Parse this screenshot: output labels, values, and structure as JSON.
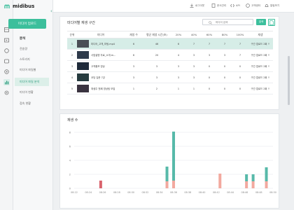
{
  "colors": {
    "accent": "#3cbf9c",
    "views": "#57b9a9",
    "secondary": "#f2a99f",
    "highlight": "#d9636d"
  },
  "brand": {
    "name": "midibus"
  },
  "sidebar": {
    "upload_label": "미디어 업로드",
    "section_label": "분석",
    "items": [
      {
        "label": "전송량"
      },
      {
        "label": "스토리지"
      },
      {
        "label": "미디어 파일별"
      },
      {
        "label": "미디어 파일 분석"
      },
      {
        "label": "미디어 현황"
      },
      {
        "label": "접속 현황"
      }
    ]
  },
  "topbar": {
    "items": [
      {
        "label": "로그아웃",
        "icon": "logout-icon"
      },
      {
        "label": "문서관리",
        "icon": "document-icon"
      },
      {
        "label": "API",
        "icon": "api-icon"
      },
      {
        "label": "고객센터",
        "icon": "support-icon"
      },
      {
        "label": "알림보기",
        "icon": "bell-icon"
      }
    ]
  },
  "table_card": {
    "title": "미디어별 재생 구간",
    "search_placeholder": "미디어 검색",
    "search_label": "검색",
    "columns": [
      "순위",
      "미디어",
      "재생 수",
      "평균 재생 시간(초)",
      "20%",
      "40%",
      "60%",
      "80%",
      "100%",
      "재생"
    ],
    "rows": [
      {
        "rank": "1",
        "title": "미디어_고객_미팅.mp4",
        "plays": "6",
        "avg": "46",
        "p20": "6",
        "p40": "7",
        "p60": "7",
        "p80": "7",
        "p100": "7",
        "action": "구간 업로드 2회 ↑"
      },
      {
        "rank": "2",
        "title": "사업설명 자료_소개.m...",
        "plays": "6",
        "avg": "20",
        "p20": "4",
        "p40": "3",
        "p60": "3",
        "p80": "3",
        "p100": "7",
        "action": "구간 업로드 2회 ↑"
      },
      {
        "rank": "3",
        "title": "고객홍보 영상",
        "plays": "3",
        "avg": "3",
        "p20": "3",
        "p40": "3",
        "p60": "0",
        "p80": "0",
        "p100": "0",
        "action": "구간 업로드 2회 ↑"
      },
      {
        "rank": "4",
        "title": "코딩 입문 7강",
        "plays": "3",
        "avg": "3",
        "p20": "3",
        "p40": "3",
        "p60": "0",
        "p80": "0",
        "p100": "0",
        "action": "구간 업로드 2회 ↑"
      },
      {
        "rank": "5",
        "title": "재생주 첫째 영상팀 모집",
        "plays": "1",
        "avg": "2",
        "p20": "1",
        "p40": "1",
        "p60": "0",
        "p80": "0",
        "p100": "0",
        "action": "구간 업로드 2회 ↑"
      }
    ]
  },
  "chart_card": {
    "title": "재생 수"
  },
  "chart_data": {
    "type": "bar",
    "categories": [
      "08:22",
      "08:24",
      "08:26",
      "08:28",
      "08:30",
      "08:32",
      "08:34",
      "08:36",
      "08:38",
      "08:40",
      "08:42",
      "08:44",
      "08:46",
      "08:48",
      "08:50",
      "08:52",
      "08:54",
      "08:56",
      "08:58",
      "09:00",
      "09:02",
      "09:04",
      "09:06",
      "09:08",
      "09:10",
      "09:12",
      "09:14",
      "09:16",
      "09:18",
      "09:20",
      "09:22"
    ],
    "tick_labels": [
      "08:22",
      "08:24",
      "08:26",
      "08:28",
      "08:30",
      "08:32",
      "08:34",
      "08:36",
      "08:38",
      "08:40",
      "08:42",
      "08:44",
      "08:46",
      "08:48",
      "08:50"
    ],
    "series": [
      {
        "values": [
          0,
          0,
          0,
          0,
          0,
          0,
          0,
          0,
          0,
          0,
          0,
          0,
          0,
          0,
          0,
          0,
          0,
          0,
          0,
          0,
          0,
          0,
          0,
          0,
          0,
          0,
          0,
          0,
          0,
          0,
          0
        ]
      },
      {
        "values": [
          0,
          0,
          0,
          0,
          1,
          0,
          0,
          0,
          0,
          0,
          0,
          0,
          0,
          0,
          0,
          1,
          0,
          0,
          0,
          0,
          0,
          0,
          0,
          0,
          0,
          0,
          0,
          0,
          0,
          0,
          0
        ]
      },
      {
        "values": [
          0,
          0,
          0,
          0,
          0,
          0,
          0,
          0,
          0,
          0,
          0,
          0,
          0,
          0,
          0,
          0,
          0,
          0,
          0,
          0,
          0,
          0,
          0,
          0,
          0,
          0,
          0,
          0,
          0,
          0,
          0
        ]
      }
    ],
    "bars": [
      {
        "x": 4,
        "values": [
          0,
          1.1,
          0
        ]
      },
      {
        "x": 14,
        "values": [
          1.0,
          0,
          2.1
        ]
      },
      {
        "x": 15,
        "values": [
          1.1,
          0,
          7.0
        ]
      },
      {
        "x": 22,
        "values": [
          2.1,
          0,
          0
        ]
      },
      {
        "x": 26,
        "values": [
          1.0,
          0,
          1.0
        ]
      },
      {
        "x": 27,
        "values": [
          1.0,
          0,
          1.0
        ]
      },
      {
        "x": 29,
        "values": [
          1.0,
          0,
          2.0
        ]
      }
    ],
    "yticks": [
      0,
      2,
      4,
      6,
      8
    ],
    "ylim": [
      0,
      8
    ]
  }
}
